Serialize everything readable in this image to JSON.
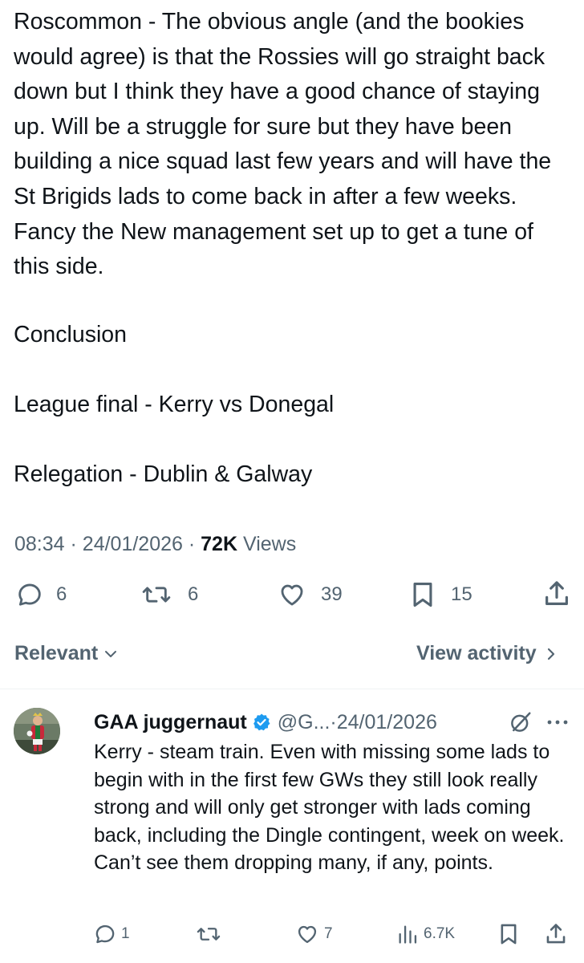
{
  "post": {
    "paragraphs": [
      "Roscommon - The obvious angle (and the bookies would agree) is that the Rossies will go straight back down but I think they have a good chance of staying up. Will be a struggle for sure but they have been building a nice squad last few years and will have the St Brigids lads to come back in after a few weeks. Fancy the New management set up to get a tune of this side.",
      "Conclusion",
      "League final - Kerry vs Donegal",
      "Relegation - Dublin & Galway"
    ],
    "time": "08:34",
    "date": "24/01/2026",
    "views_count": "72K",
    "views_label": "Views",
    "stats": {
      "replies": "6",
      "reposts": "6",
      "likes": "39",
      "bookmarks": "15"
    }
  },
  "sort": {
    "label": "Relevant",
    "view_activity": "View activity"
  },
  "reply": {
    "name": "GAA juggernaut",
    "handle": "@G...",
    "date": "24/01/2026",
    "text": "Kerry - steam train. Even with missing some lads to begin with in the first few GWs they still look really strong and will only get stronger with lads coming back, including the Dingle contingent, week on week. Can’t see them dropping many, if any, points.",
    "stats": {
      "replies": "1",
      "likes": "7",
      "views": "6.7K"
    }
  },
  "colors": {
    "text": "#0f1419",
    "secondary": "#536471",
    "verified": "#1d9bf0",
    "divider": "#eff3f4"
  }
}
